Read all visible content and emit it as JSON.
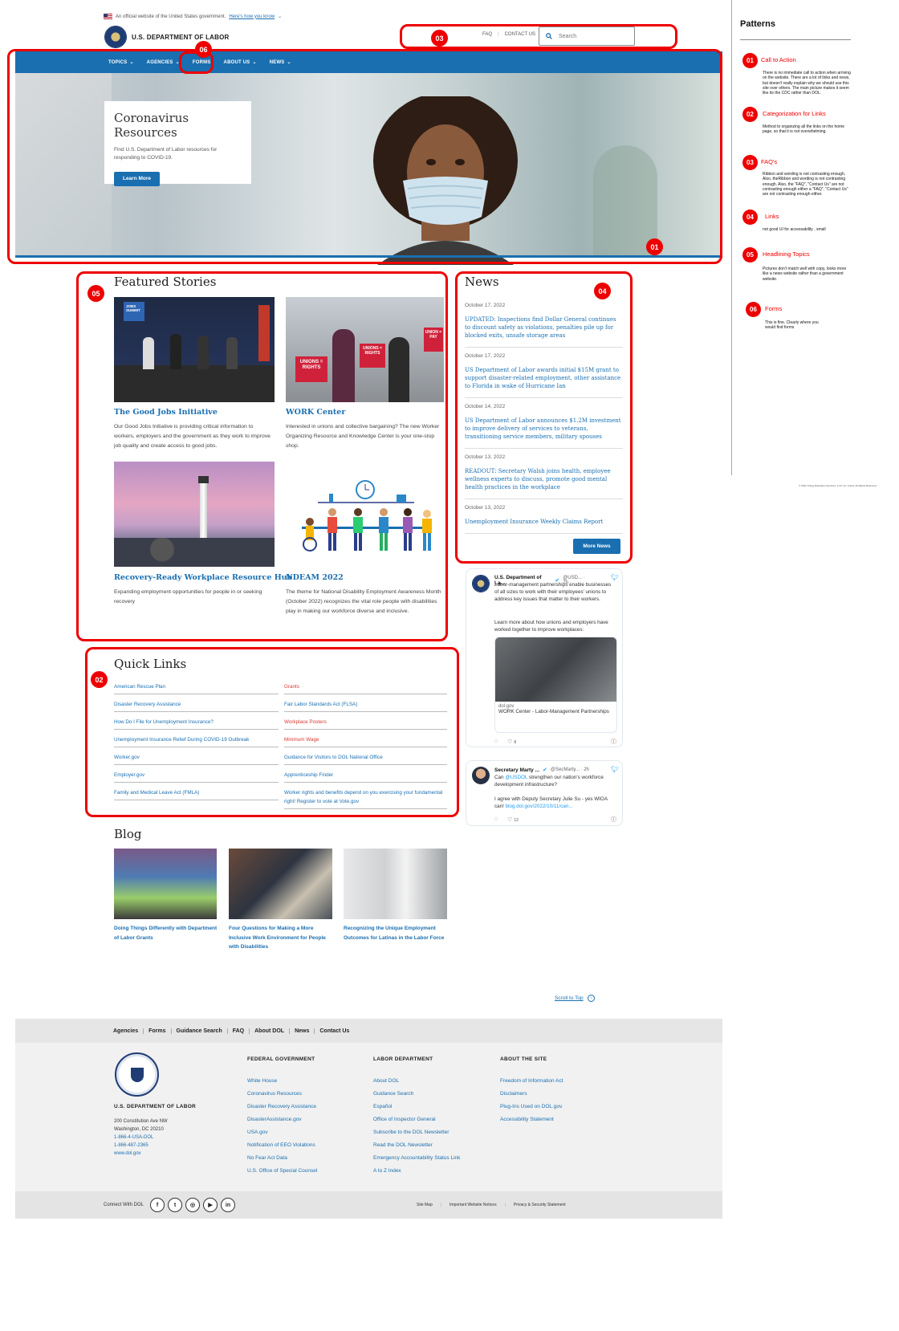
{
  "gov_banner": {
    "text": "An official website of the United States government.",
    "link": "Here's how you know"
  },
  "brand": {
    "name": "U.S. DEPARTMENT OF LABOR"
  },
  "utility": {
    "faq": "FAQ",
    "contact": "CONTACT US",
    "search_placeholder": "Search"
  },
  "nav": {
    "items": [
      "TOPICS",
      "AGENCIES",
      "FORMS",
      "ABOUT US",
      "NEWS"
    ]
  },
  "hero": {
    "title": "Coronavirus Resources",
    "text": "Find U.S. Department of Labor resources for responding to COVID-19.",
    "button": "Learn More"
  },
  "featured": {
    "title": "Featured Stories",
    "stories": [
      {
        "title": "The Good Jobs Initiative",
        "text": "Our Good Jobs Initiative is providing critical information to workers, employers and the government as they work to improve job quality and create access to good jobs."
      },
      {
        "title": "WORK Center",
        "text": "Interested in unions and collective bargaining? The new Worker Organizing Resource and Knowledge Center is your one-stop shop."
      },
      {
        "title": "Recovery-Ready Workplace Resource Hub",
        "text": "Expanding employment opportunities for people in or seeking recovery"
      },
      {
        "title": "NDEAM 2022",
        "text": "The theme for National Disability Employment Awareness Month (October 2022) recognizes the vital role people with disabilities play in making our workforce diverse and inclusive."
      }
    ],
    "image_captions": {
      "jobs_summit": "JOBS SUMMIT",
      "unions_rights": "UNIONS = RIGHTS",
      "union_pay": "UNION = PAY"
    }
  },
  "news": {
    "title": "News",
    "items": [
      {
        "date": "October 17, 2022",
        "title": "UPDATED: Inspections find Dollar General continues to discount safety as violations, penalties pile up for blocked exits, unsafe storage areas"
      },
      {
        "date": "October 17, 2022",
        "title": "US Department of Labor awards initial $15M grant to support disaster-related employment, other assistance to Florida in wake of Hurricane Ian"
      },
      {
        "date": "October 14, 2022",
        "title": "US Department of Labor announces $1.2M investment to improve delivery of services to veterans, transitioning service members, military spouses"
      },
      {
        "date": "October 13, 2022",
        "title": "READOUT: Secretary Walsh joins health, employee wellness experts to discuss, promote good mental health practices in the workplace"
      },
      {
        "date": "October 13, 2022",
        "title": "Unemployment Insurance Weekly Claims Report"
      }
    ],
    "more_button": "More News"
  },
  "tweets": [
    {
      "name": "U.S. Department of La...",
      "handle": "@USD... · 7h",
      "text": "Labor-management partnerships enable businesses of all sizes to work with their employees' unions to address key issues that matter to their workers.",
      "text2": "Learn more about how unions and employers have worked together to improve workplaces:",
      "card_domain": "dol.gov",
      "card_title": "WORK Center - Labor-Management Partnerships",
      "likes": "8"
    },
    {
      "name": "Secretary Marty ...",
      "handle": "@SecMarty... · 2h",
      "text_pre": "Can ",
      "mention": "@USDOL",
      "text_post": " strengthen our nation's workforce development infrastructure?",
      "text2": "I agree with Deputy Secretary Julie Su - yes WIOA can!",
      "link": "blog.dol.gov/2022/10/11/can...",
      "likes": "12"
    }
  ],
  "quick_links": {
    "title": "Quick Links",
    "left": [
      "American Rescue Plan",
      "Disaster Recovery Assistance",
      "How Do I File for Unemployment Insurance?",
      "Unemployment Insurance Relief During COVID-19 Outbreak",
      "Worker.gov",
      "Employer.gov",
      "Family and Medical Leave Act (FMLA)"
    ],
    "right": [
      "Grants",
      "Fair Labor Standards Act (FLSA)",
      "Workplace Posters",
      "Minimum Wage",
      "Guidance for Visitors to DOL National Office",
      "Apprenticeship Finder",
      "Worker rights and benefits depend on you exercising your fundamental right! Register to vote at Vote.gov"
    ]
  },
  "blog": {
    "title": "Blog",
    "posts": [
      "Doing Things Differently with Department of Labor Grants",
      "Four Questions for Making a More Inclusive Work Environment for People with Disabilities",
      "Recognizing the Unique Employment Outcomes for Latinas in the Labor Force"
    ]
  },
  "scroll_top": "Scroll to Top",
  "footer": {
    "nav": [
      "Agencies",
      "Forms",
      "Guidance Search",
      "FAQ",
      "About DOL",
      "News",
      "Contact Us"
    ],
    "org_name": "U.S. DEPARTMENT OF LABOR",
    "address1": "200 Constitution Ave NW",
    "address2": "Washington, DC 20210",
    "phone1": "1-866-4-USA-DOL",
    "phone2": "1-866-487-2365",
    "website": "www.dol.gov",
    "columns": [
      {
        "heading": "FEDERAL GOVERNMENT",
        "links": [
          "White House",
          "Coronavirus Resources",
          "Disaster Recovery Assistance",
          "DisasterAssistance.gov",
          "USA.gov",
          "Notification of EEO Violations",
          "No Fear Act Data",
          "U.S. Office of Special Counsel"
        ]
      },
      {
        "heading": "LABOR DEPARTMENT",
        "links": [
          "About DOL",
          "Guidance Search",
          "Español",
          "Office of Inspector General",
          "Subscribe to the DOL Newsletter",
          "Read the DOL Newsletter",
          "Emergency Accountability Status Link",
          "A to Z Index"
        ]
      },
      {
        "heading": "ABOUT THE SITE",
        "links": [
          "Freedom of Information Act",
          "Disclaimers",
          "Plug-Ins Used on DOL.gov",
          "Accessibility Statement"
        ]
      }
    ],
    "connect": "Connect With DOL",
    "bottom_links": [
      "Site Map",
      "Important Website Notices",
      "Privacy & Security Statement"
    ]
  },
  "annotations": [
    "01",
    "02",
    "03",
    "04",
    "05",
    "06"
  ],
  "patterns": {
    "title": "Patterns",
    "items": [
      {
        "num": "01",
        "heading": "Call to Action",
        "text": "There is no immediate call to action when arriving on the website. There are a lot of links and news, but doesn't really explain why we should use this site over others. The main picture makes it seem like its the CDC rather than DOL."
      },
      {
        "num": "02",
        "heading": "Categorization for Links",
        "text": "Method to organizing all the links on the home page, so that it is not overwhelming."
      },
      {
        "num": "03",
        "heading": "FAQ's",
        "text": "Ribbon and wording is not contrasting enough. Also, theRibbon and wording is not contrasting enough. Also, the \"FAQ\", \"Contact Us\" are not contrasting enough either a \"FAQ\", \"Contact Us\" are not contrasting enough either."
      },
      {
        "num": "04",
        "heading": "Links",
        "text": "not good UI for accessability , small"
      },
      {
        "num": "05",
        "heading": "Headlining Topics",
        "text": "Pictures don't match well with copy, looks more like a news website rather than a government website."
      },
      {
        "num": "06",
        "heading": "Forms",
        "text": "This is fine. Clearly where you would find forms"
      }
    ],
    "copyright": "© 2022 Trilogy Education Services, a 2U, Inc. brand. All Rights Reserved."
  },
  "colors": {
    "primary": "#1a6fb0",
    "annotation_red": "#e00000",
    "footer_bg": "#f1f1f1"
  }
}
